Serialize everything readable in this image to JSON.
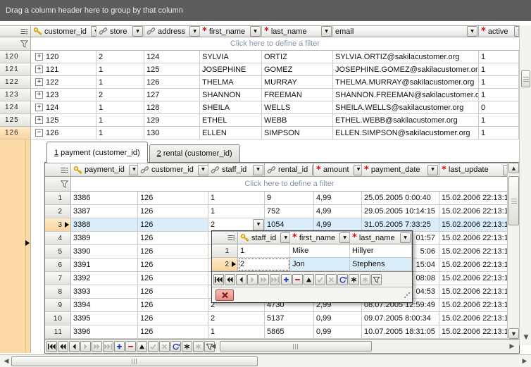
{
  "group_panel": {
    "text": "Drag a column header here to group by that column"
  },
  "filter_hint": "Click here to define a filter",
  "main_grid": {
    "columns": [
      {
        "label": "customer_id",
        "icon": "key"
      },
      {
        "label": "store",
        "icon": "link"
      },
      {
        "label": "address",
        "icon": "link"
      },
      {
        "label": "first_name",
        "icon": "required"
      },
      {
        "label": "last_name",
        "icon": "required"
      },
      {
        "label": "email",
        "icon": "none"
      },
      {
        "label": "active",
        "icon": "required"
      }
    ],
    "rows": [
      {
        "num": "120",
        "expanded": false,
        "cells": [
          "120",
          "2",
          "124",
          "SYLVIA",
          "ORTIZ",
          "SYLVIA.ORTIZ@sakilacustomer.org",
          "1"
        ]
      },
      {
        "num": "121",
        "expanded": false,
        "cells": [
          "121",
          "1",
          "125",
          "JOSEPHINE",
          "GOMEZ",
          "JOSEPHINE.GOMEZ@sakilacustomer.org",
          "1"
        ]
      },
      {
        "num": "122",
        "expanded": false,
        "cells": [
          "122",
          "1",
          "126",
          "THELMA",
          "MURRAY",
          "THELMA.MURRAY@sakilacustomer.org",
          "1"
        ]
      },
      {
        "num": "123",
        "expanded": false,
        "cells": [
          "123",
          "2",
          "127",
          "SHANNON",
          "FREEMAN",
          "SHANNON.FREEMAN@sakilacustomer.org",
          "1"
        ]
      },
      {
        "num": "124",
        "expanded": false,
        "cells": [
          "124",
          "1",
          "128",
          "SHEILA",
          "WELLS",
          "SHEILA.WELLS@sakilacustomer.org",
          "0"
        ]
      },
      {
        "num": "125",
        "expanded": false,
        "cells": [
          "125",
          "1",
          "129",
          "ETHEL",
          "WEBB",
          "ETHEL.WEBB@sakilacustomer.org",
          "1"
        ]
      },
      {
        "num": "126",
        "expanded": true,
        "cells": [
          "126",
          "1",
          "130",
          "ELLEN",
          "SIMPSON",
          "ELLEN.SIMPSON@sakilacustomer.org",
          "1"
        ]
      }
    ]
  },
  "detail": {
    "tabs": [
      {
        "accel": "1",
        "label": " payment (customer_id)",
        "active": true
      },
      {
        "accel": "2",
        "label": " rental (customer_id)",
        "active": false
      }
    ],
    "columns": [
      {
        "label": "payment_id",
        "icon": "key"
      },
      {
        "label": "customer_id",
        "icon": "link"
      },
      {
        "label": "staff_id",
        "icon": "link"
      },
      {
        "label": "rental_id",
        "icon": "link"
      },
      {
        "label": "amount",
        "icon": "required"
      },
      {
        "label": "payment_date",
        "icon": "required"
      },
      {
        "label": "last_update",
        "icon": "required"
      }
    ],
    "rows": [
      {
        "num": "1",
        "cells": [
          "3386",
          "126",
          "1",
          "9",
          "4,99",
          "25.05.2005 0:00:40",
          "15.02.2006 22:13:1"
        ]
      },
      {
        "num": "2",
        "cells": [
          "3387",
          "126",
          "1",
          "752",
          "4,99",
          "29.05.2005 10:14:15",
          "15.02.2006 22:13:1"
        ]
      },
      {
        "num": "3",
        "focused": true,
        "cells": [
          "3388",
          "126",
          "2",
          "1054",
          "4,99",
          "31.05.2005 7:33:25",
          "15.02.2006 22:13:1"
        ]
      },
      {
        "num": "4",
        "covered": true,
        "cells": [
          "3389",
          "126",
          "",
          "",
          "",
          "01:57",
          "15.02.2006 22:13:1"
        ]
      },
      {
        "num": "5",
        "covered": true,
        "cells": [
          "3390",
          "126",
          "",
          "",
          "",
          "5:06",
          "15.02.2006 22:13:1"
        ]
      },
      {
        "num": "6",
        "covered": true,
        "cells": [
          "3391",
          "126",
          "",
          "",
          "",
          "15:04",
          "15.02.2006 22:13:1"
        ]
      },
      {
        "num": "7",
        "covered": true,
        "cells": [
          "3392",
          "126",
          "",
          "",
          "",
          "08:08",
          "15.02.2006 22:13:1"
        ]
      },
      {
        "num": "8",
        "covered": true,
        "cells": [
          "3393",
          "126",
          "",
          "",
          "",
          "04:53",
          "15.02.2006 22:13:1"
        ]
      },
      {
        "num": "9",
        "cells": [
          "3394",
          "126",
          "2",
          "4730",
          "2,99",
          "08.07.2005 12:59:49",
          "15.02.2006 22:13:1"
        ]
      },
      {
        "num": "10",
        "cells": [
          "3395",
          "126",
          "2",
          "5137",
          "0,99",
          "09.07.2005 8:00:34",
          "15.02.2006 22:13:1"
        ]
      },
      {
        "num": "11",
        "cells": [
          "3396",
          "126",
          "1",
          "5865",
          "0,99",
          "10.07.2005 18:31:05",
          "15.02.2006 22:13:1"
        ]
      }
    ]
  },
  "dropdown": {
    "columns": [
      {
        "label": "staff_id",
        "icon": "key"
      },
      {
        "label": "first_name",
        "icon": "required"
      },
      {
        "label": "last_name",
        "icon": "required"
      }
    ],
    "rows": [
      {
        "num": "1",
        "cells": [
          "1",
          "Mike",
          "Hillyer"
        ]
      },
      {
        "num": "2",
        "focused": true,
        "cells": [
          "2",
          "Jon",
          "Stephens"
        ]
      }
    ]
  },
  "navigator": {
    "buttons": [
      {
        "name": "first",
        "enabled": true
      },
      {
        "name": "prior-page",
        "enabled": true
      },
      {
        "name": "prior",
        "enabled": true
      },
      {
        "name": "next",
        "enabled": false
      },
      {
        "name": "next-page",
        "enabled": false
      },
      {
        "name": "last",
        "enabled": false
      },
      {
        "name": "insert",
        "enabled": true
      },
      {
        "name": "delete",
        "enabled": true
      },
      {
        "name": "edit",
        "enabled": true
      },
      {
        "name": "post",
        "enabled": false
      },
      {
        "name": "cancel",
        "enabled": false
      },
      {
        "name": "refresh",
        "enabled": true
      },
      {
        "name": "bookmark",
        "enabled": true
      },
      {
        "name": "goto-bookmark",
        "enabled": false
      },
      {
        "name": "filter",
        "enabled": true
      }
    ]
  },
  "colors": {
    "focus_row": "#d9edfb",
    "focus_indicator": "#fbd49c",
    "group_panel": "#5d5d5d",
    "required_mark": "#d01010",
    "key_icon": "#dd9f00"
  }
}
